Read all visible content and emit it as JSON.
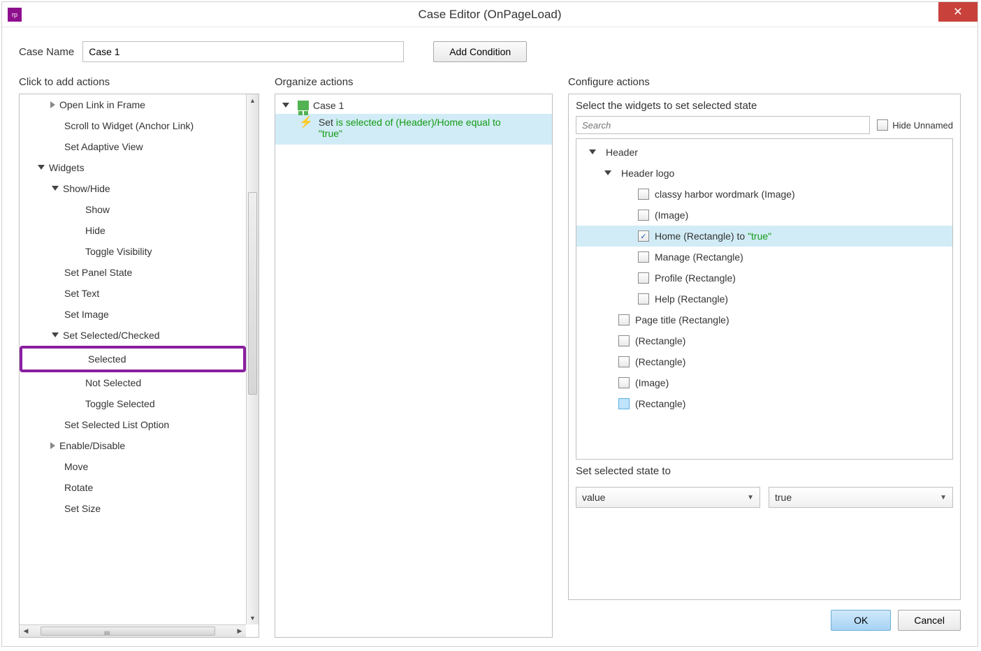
{
  "window": {
    "title": "Case Editor (OnPageLoad)"
  },
  "case": {
    "label": "Case Name",
    "value": "Case 1",
    "add_condition": "Add Condition"
  },
  "columns": {
    "left_title": "Click to add actions",
    "mid_title": "Organize actions",
    "right_title": "Configure actions"
  },
  "actions": {
    "open_link_frame": "Open Link in Frame",
    "scroll_widget": "Scroll to Widget (Anchor Link)",
    "set_adaptive": "Set Adaptive View",
    "widgets": "Widgets",
    "show_hide": "Show/Hide",
    "show": "Show",
    "hide": "Hide",
    "toggle_vis": "Toggle Visibility",
    "set_panel": "Set Panel State",
    "set_text": "Set Text",
    "set_image": "Set Image",
    "set_sel_chk": "Set Selected/Checked",
    "selected": "Selected",
    "not_selected": "Not Selected",
    "toggle_selected": "Toggle Selected",
    "set_list": "Set Selected List Option",
    "enable_disable": "Enable/Disable",
    "move": "Move",
    "rotate": "Rotate",
    "set_size": "Set Size"
  },
  "organize": {
    "case_label": "Case 1",
    "action_prefix": "Set",
    "action_green1": "is selected of (Header)/Home equal to",
    "action_green2": "\"true\""
  },
  "configure": {
    "prompt": "Select the widgets to set selected state",
    "search_placeholder": "Search",
    "hide_unnamed": "Hide Unnamed",
    "tree": {
      "header": "Header",
      "header_logo": "Header logo",
      "wordmark": "classy harbor wordmark (Image)",
      "image": "(Image)",
      "home_pre": "Home (Rectangle) to",
      "home_val": "\"true\"",
      "manage": "Manage (Rectangle)",
      "profile": "Profile (Rectangle)",
      "help": "Help (Rectangle)",
      "page_title": "Page title (Rectangle)",
      "rect1": "(Rectangle)",
      "rect2": "(Rectangle)",
      "image2": "(Image)",
      "rect3": "(Rectangle)"
    },
    "state_label": "Set selected state to",
    "state_value": "value",
    "state_true": "true"
  },
  "buttons": {
    "ok": "OK",
    "cancel": "Cancel"
  }
}
